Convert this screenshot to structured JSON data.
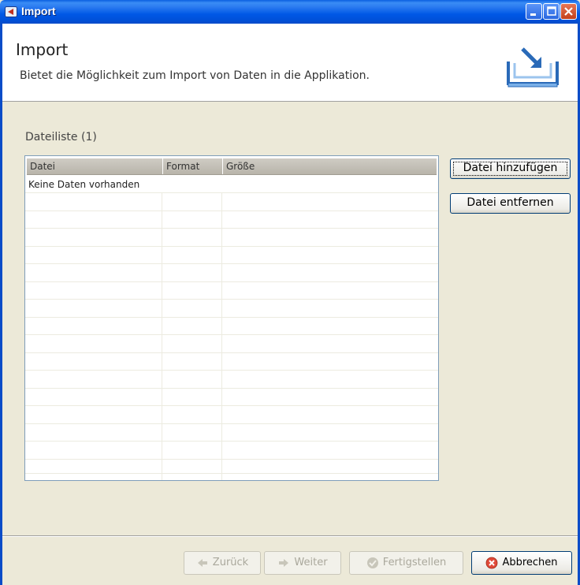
{
  "window": {
    "title": "Import"
  },
  "header": {
    "title": "Import",
    "description": "Bietet die Möglichkeit zum Import von Daten in die Applikation.",
    "icon": "import-tray-icon"
  },
  "file_list": {
    "label": "Dateiliste (1)",
    "columns": [
      "Datei",
      "Format",
      "Größe"
    ],
    "empty_message": "Keine Daten vorhanden",
    "rows": []
  },
  "side_buttons": {
    "add_label": "Datei hinzufügen",
    "remove_label": "Datei entfernen"
  },
  "footer": {
    "back_label": "Zurück",
    "next_label": "Weiter",
    "finish_label": "Fertigstellen",
    "cancel_label": "Abbrechen"
  },
  "colors": {
    "titlebar": "#0058e6",
    "accent_border": "#003c74",
    "cancel_icon": "#e04a3a"
  }
}
